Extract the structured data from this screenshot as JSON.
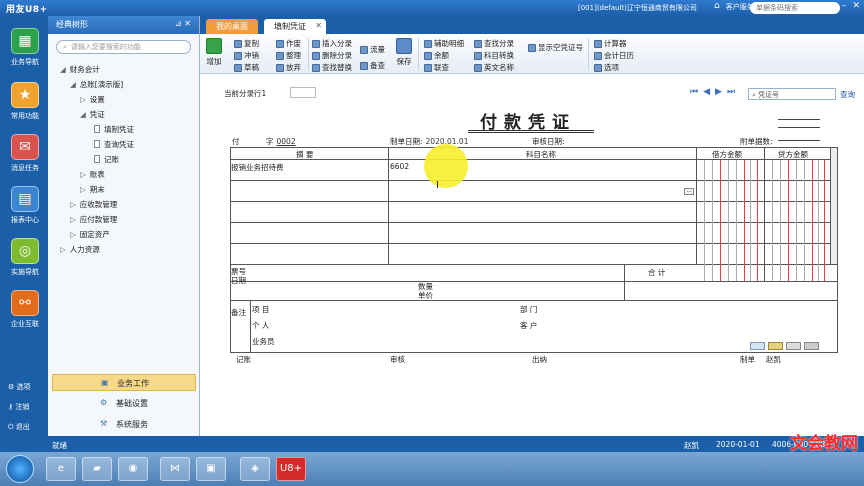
{
  "titlebar": {
    "logo": "用友U8+",
    "account": "[001](default)辽宁恒通商贸有限公司",
    "customer_service": "客户服务",
    "search_placeholder": "单据条码搜索"
  },
  "leftnav": {
    "items": [
      {
        "label": "业务导航",
        "icon": "grid-icon"
      },
      {
        "label": "常用功能",
        "icon": "star-icon"
      },
      {
        "label": "消息任务",
        "icon": "message-icon"
      },
      {
        "label": "报表中心",
        "icon": "report-icon"
      },
      {
        "label": "实施导航",
        "icon": "compass-icon"
      },
      {
        "label": "企业互联",
        "icon": "link-icon"
      }
    ],
    "bottom": [
      {
        "label": "选项",
        "icon": "gear-icon"
      },
      {
        "label": "注销",
        "icon": "key-icon"
      },
      {
        "label": "退出",
        "icon": "exit-icon"
      }
    ]
  },
  "panel": {
    "title": "经典树形",
    "search_placeholder": "请输入您要搜索的功能",
    "tree": [
      "财务会计",
      "总账[演示版]",
      "设置",
      "凭证",
      "填制凭证",
      "查询凭证",
      "记账",
      "账表",
      "期末",
      "应收款管理",
      "应付款管理",
      "固定资产",
      "人力资源"
    ],
    "bottom_tabs": [
      "业务工作",
      "基础设置",
      "系统服务"
    ]
  },
  "tabs": {
    "desktop": "我的桌面",
    "voucher": "填制凭证"
  },
  "toolbar": {
    "add": "增加",
    "copy": "复制",
    "reverse": "冲销",
    "draft": "草稿",
    "doc": "作废",
    "tidy": "整理",
    "abandon": "放弃",
    "insert_entry": "插入分录",
    "delete_entry": "删除分录",
    "find_replace": "查找替换",
    "flow": "流量",
    "stock": "备查",
    "save": "保存",
    "aux_detail": "辅助明细",
    "balance": "余额",
    "query": "联查",
    "find_entry": "查找分录",
    "acct_convert": "科目转换",
    "en_name": "英文名称",
    "show_voucher_no": "显示空凭证号",
    "calculator": "计算器",
    "acct_calendar": "会计日历",
    "options": "选项"
  },
  "voucher": {
    "current_entry": "当前分录行1",
    "search_placeholder": "凭证号",
    "query": "查询",
    "title": "付款凭证",
    "type_label": "付",
    "word_label": "字",
    "voucher_no": "0002",
    "date_label": "制单日期:",
    "date": "2020.01.01",
    "review_label": "审核日期:",
    "attach_label": "附单据数:",
    "cols": {
      "summary": "摘 要",
      "account": "科目名称",
      "debit": "借方金额",
      "credit": "贷方金额"
    },
    "rows": [
      {
        "summary": "报销业务招待费",
        "account": "6602"
      },
      {
        "summary": "",
        "account": ""
      },
      {
        "summary": "",
        "account": ""
      },
      {
        "summary": "",
        "account": ""
      },
      {
        "summary": "",
        "account": ""
      }
    ],
    "footer": {
      "ticket_no": "票号",
      "date": "日期",
      "qty": "数量",
      "unit_price": "单价",
      "total": "合 计",
      "note": "备注",
      "project": "项 目",
      "dept": "部 门",
      "person": "个 人",
      "customer": "客 户",
      "salesman": "业务员"
    },
    "sign": {
      "bookkeep": "记账",
      "review": "审核",
      "cashier": "出纳",
      "maker": "制单",
      "maker_name": "赵凯"
    }
  },
  "status": {
    "ready": "就绪",
    "user": "赵凯",
    "date": "2020-01-01",
    "phone": "4006-600-588"
  },
  "watermark": "文会教网",
  "taskbar": {
    "apps": [
      "ie-icon",
      "folder-icon",
      "media-icon",
      "vs-icon",
      "camera-icon",
      "app-icon",
      "u8-icon"
    ],
    "u8_label": "U8+"
  },
  "colors": {
    "brand": "#1b5fa8",
    "tab_active": "#f29b3a",
    "highlight": "#f6ee2a"
  }
}
